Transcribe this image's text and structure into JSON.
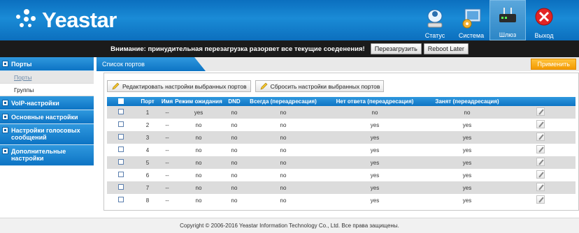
{
  "brand": {
    "name": "Yeastar"
  },
  "nav": [
    {
      "label": "Статус",
      "icon": "status-icon",
      "active": false
    },
    {
      "label": "Система",
      "icon": "system-icon",
      "active": false
    },
    {
      "label": "Шлюз",
      "icon": "gateway-icon",
      "active": true
    },
    {
      "label": "Выход",
      "icon": "logout-icon",
      "active": false
    }
  ],
  "warning": {
    "text": "Внимание: принудительная перезагрузка разорвет все текущие соеденения!",
    "reboot_label": "Перезагрузить",
    "reboot_later_label": "Reboot Later"
  },
  "sidebar": {
    "ports": "Порты",
    "ports_sub": "Порты",
    "groups_sub": "Группы",
    "voip": "VoIP-настройки",
    "basic": "Основные настройки",
    "voice": "Настройки голосовых сообщений",
    "extra": "Дополнительные настройки"
  },
  "main": {
    "tab_label": "Список портов",
    "apply_label": "Применить",
    "edit_selected": "Редактировать настройки выбранных портов",
    "reset_selected": "Сбросить настройки выбранных портов"
  },
  "table": {
    "headers": {
      "port": "Порт",
      "name": "Имя",
      "wait": "Режим ожидания",
      "dnd": "DND",
      "always": "Всегда (переадресация)",
      "noanswer": "Нет ответа (переадресация)",
      "busy": "Занят (переадресация)"
    },
    "rows": [
      {
        "port": "1",
        "name": "--",
        "wait": "yes",
        "dnd": "no",
        "always": "no",
        "noanswer": "no",
        "busy": "no"
      },
      {
        "port": "2",
        "name": "--",
        "wait": "no",
        "dnd": "no",
        "always": "no",
        "noanswer": "yes",
        "busy": "yes"
      },
      {
        "port": "3",
        "name": "--",
        "wait": "no",
        "dnd": "no",
        "always": "no",
        "noanswer": "yes",
        "busy": "yes"
      },
      {
        "port": "4",
        "name": "--",
        "wait": "no",
        "dnd": "no",
        "always": "no",
        "noanswer": "yes",
        "busy": "yes"
      },
      {
        "port": "5",
        "name": "--",
        "wait": "no",
        "dnd": "no",
        "always": "no",
        "noanswer": "yes",
        "busy": "yes"
      },
      {
        "port": "6",
        "name": "--",
        "wait": "no",
        "dnd": "no",
        "always": "no",
        "noanswer": "yes",
        "busy": "yes"
      },
      {
        "port": "7",
        "name": "--",
        "wait": "no",
        "dnd": "no",
        "always": "no",
        "noanswer": "yes",
        "busy": "yes"
      },
      {
        "port": "8",
        "name": "--",
        "wait": "no",
        "dnd": "no",
        "always": "no",
        "noanswer": "yes",
        "busy": "yes"
      }
    ]
  },
  "footer": {
    "text": "Copyright © 2006-2016 Yeastar Information Technology Co., Ltd. Все права защищены."
  },
  "colors": {
    "accent": "#0d74c4",
    "apply": "#f39a00",
    "header": "#1a8bd6"
  }
}
